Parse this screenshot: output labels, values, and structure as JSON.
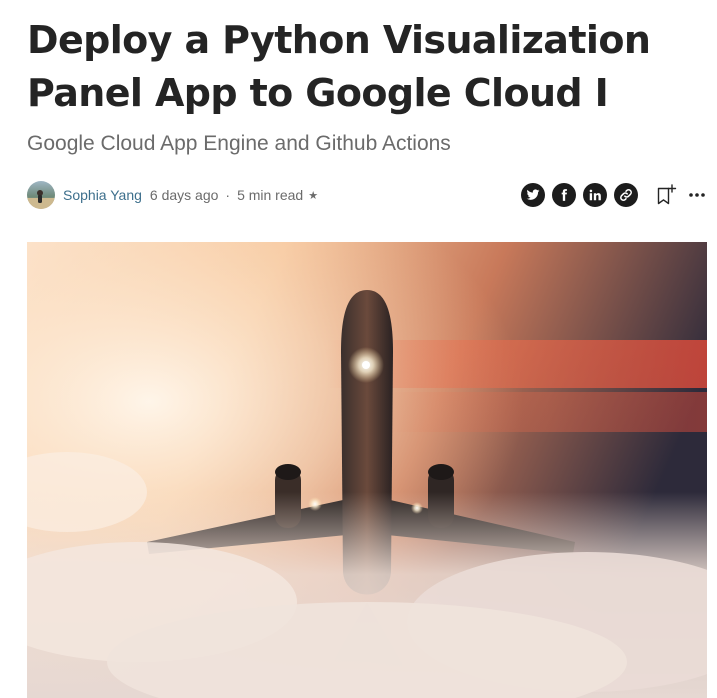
{
  "article": {
    "title": "Deploy a Python Visualization Panel App to Google Cloud I",
    "subtitle": "Google Cloud App Engine and Github Actions"
  },
  "byline": {
    "author": "Sophia Yang",
    "published": "6 days ago",
    "separator": "·",
    "read_time": "5 min read",
    "member_star": "★"
  },
  "icons": {
    "avatar": "author-avatar",
    "share_twitter": "twitter-icon",
    "share_facebook": "facebook-icon",
    "share_linkedin": "linkedin-icon",
    "copy_link": "link-icon",
    "bookmark": "bookmark-add-icon",
    "more": "more-options-icon"
  },
  "hero": {
    "subject": "airplane-climbing-through-clouds-at-sunset"
  },
  "colors": {
    "text": "#242424",
    "subtitle": "#6b6b6b",
    "author": "#3d6f8c",
    "social_bg": "#1c1c1c"
  }
}
